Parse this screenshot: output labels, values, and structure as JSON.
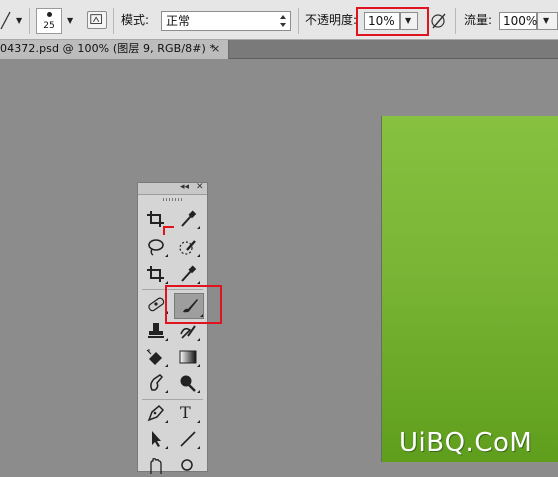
{
  "options_bar": {
    "brush_size": "25",
    "mode_label": "模式:",
    "mode_value": "正常",
    "opacity_label": "不透明度:",
    "opacity_value": "10%",
    "flow_label": "流量:",
    "flow_value": "100%"
  },
  "document_tab": {
    "title": "04372.psd @ 100% (图层 9, RGB/8#) *",
    "close": "×"
  },
  "tools_panel": {
    "collapse": "◂◂",
    "close": "✕",
    "text_tool_glyph": "T",
    "tools": [
      "crop-tool",
      "eyedropper-tool",
      "lasso-tool",
      "quick-selection-tool",
      "crop-tool-2",
      "color-sampler-tool",
      "spot-healing-tool",
      "brush-tool",
      "clone-stamp-tool",
      "history-brush-tool",
      "eraser-tool",
      "gradient-tool",
      "smudge-tool",
      "dodge-tool",
      "pen-tool",
      "text-tool",
      "path-selection-tool",
      "line-tool"
    ]
  },
  "highlight_color": "#e0141e",
  "canvas_color": "#7ab536",
  "watermark": "UiBQ.CoM"
}
